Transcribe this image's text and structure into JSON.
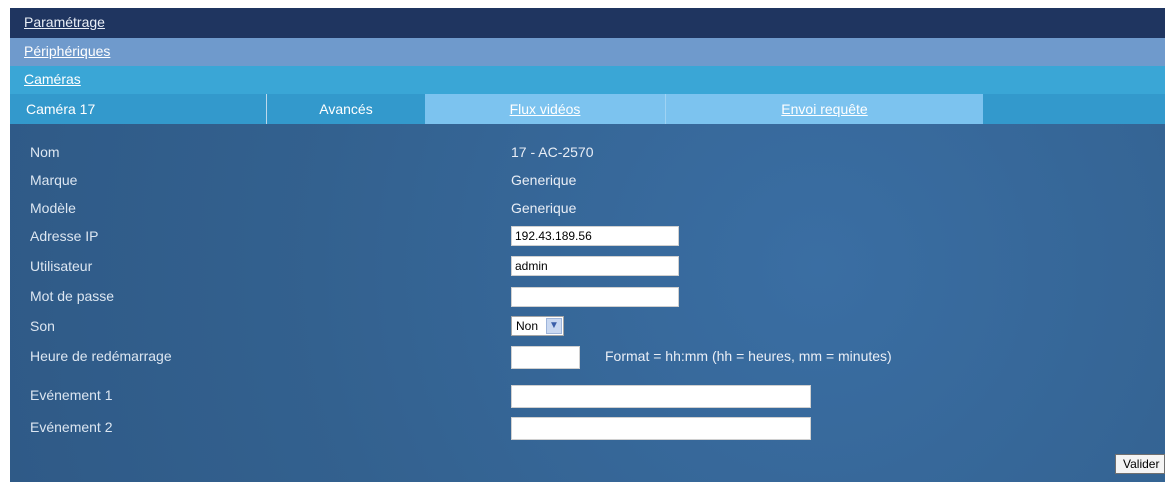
{
  "nav": {
    "parametrage": "Paramétrage",
    "peripheriques": "Périphériques",
    "cameras": "Caméras"
  },
  "tabs": {
    "camera": "Caméra 17",
    "avances": "Avancés",
    "flux": "Flux vidéos",
    "envoi": "Envoi requête"
  },
  "form": {
    "nom": {
      "label": "Nom",
      "value": "17 - AC-2570"
    },
    "marque": {
      "label": "Marque",
      "value": "Generique"
    },
    "modele": {
      "label": "Modèle",
      "value": "Generique"
    },
    "ip": {
      "label": "Adresse IP",
      "value": "192.43.189.56"
    },
    "user": {
      "label": "Utilisateur",
      "value": "admin"
    },
    "password": {
      "label": "Mot de passe",
      "value": ""
    },
    "son": {
      "label": "Son",
      "value": "Non"
    },
    "reboot": {
      "label": "Heure de redémarrage",
      "value": "",
      "hint": "Format = hh:mm  (hh = heures, mm = minutes)"
    },
    "event1": {
      "label": "Evénement 1",
      "value": ""
    },
    "event2": {
      "label": "Evénement 2",
      "value": ""
    }
  },
  "buttons": {
    "submit": "Valider"
  },
  "colors": {
    "nav_dark": "#1f3560",
    "nav_mid": "#6f9acc",
    "nav_light": "#3aa6d6",
    "tab_inactive": "#7cc3ef",
    "panel": "#356698"
  }
}
